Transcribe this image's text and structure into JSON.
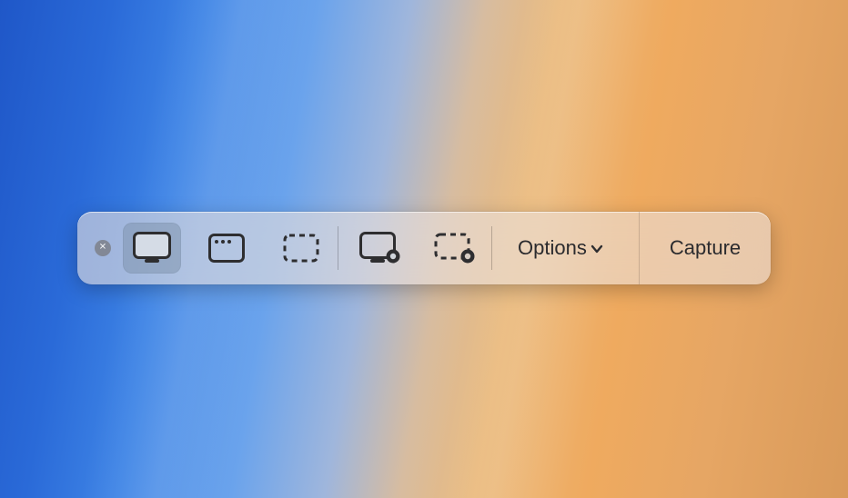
{
  "toolbar": {
    "close_name": "close-icon",
    "modes": [
      {
        "name": "capture-entire-screen",
        "selected": true
      },
      {
        "name": "capture-selected-window",
        "selected": false
      },
      {
        "name": "capture-selected-portion",
        "selected": false
      },
      {
        "name": "record-entire-screen",
        "selected": false
      },
      {
        "name": "record-selected-portion",
        "selected": false
      }
    ],
    "options_label": "Options",
    "capture_label": "Capture"
  }
}
